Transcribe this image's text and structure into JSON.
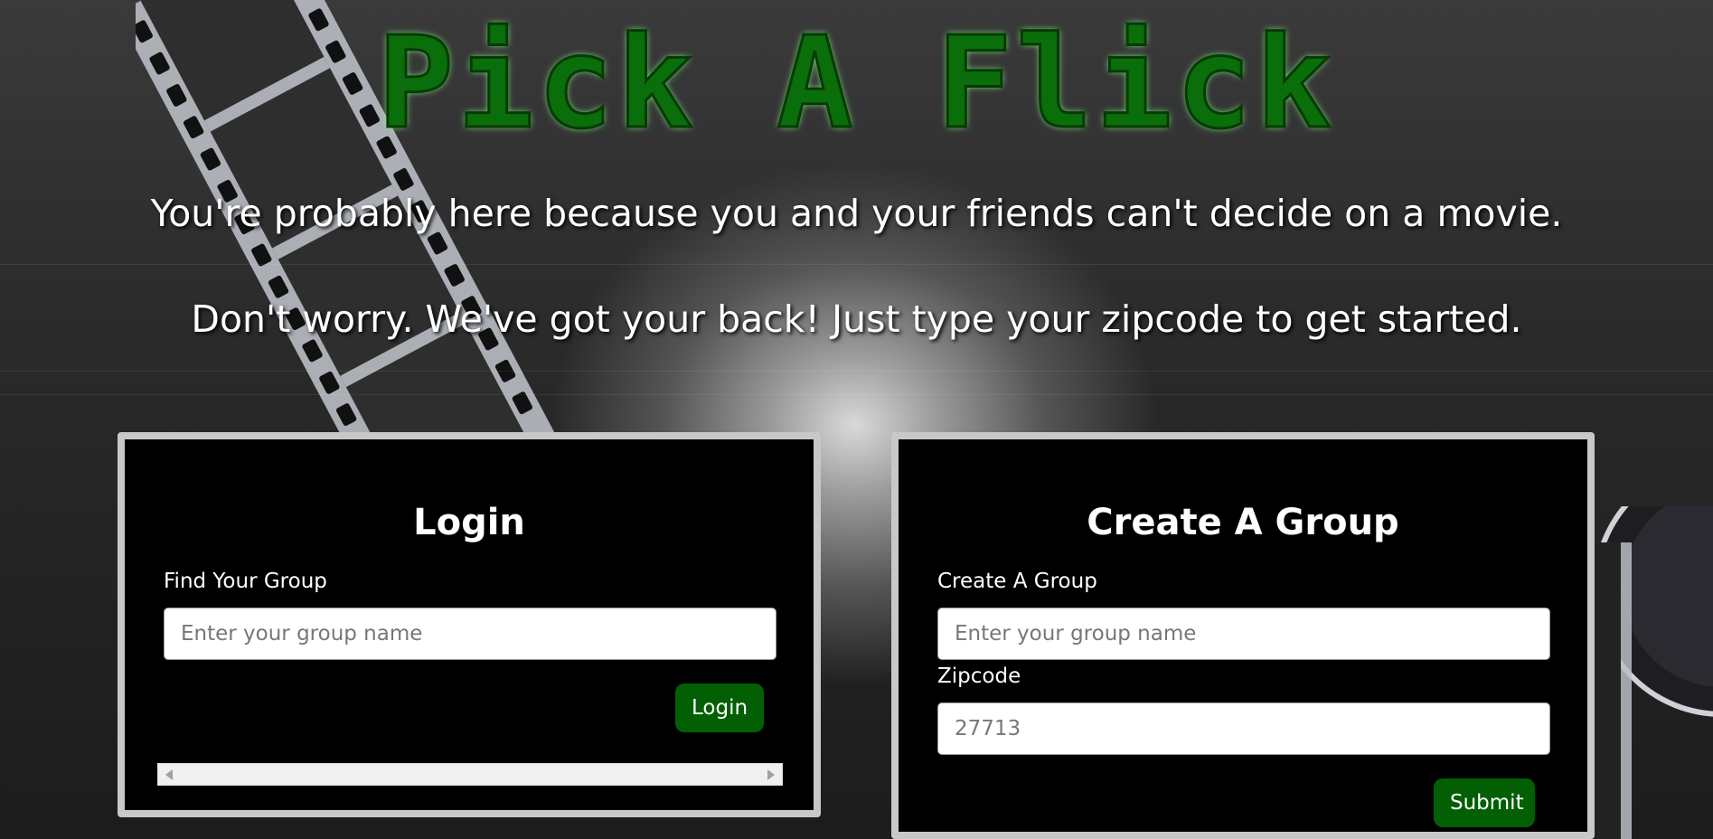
{
  "header": {
    "title": "Pick A Flick",
    "tagline_1": "You're probably here because you and your friends can't decide on a movie.",
    "tagline_2": "Don't worry. We've got your back! Just type your zipcode to get started."
  },
  "login_card": {
    "heading": "Login",
    "group_label": "Find Your Group",
    "group_placeholder": "Enter your group name",
    "button_label": "Login"
  },
  "group_card": {
    "heading": "Create A Group",
    "group_label": "Create A Group",
    "group_placeholder": "Enter your group name",
    "zip_label": "Zipcode",
    "zip_placeholder": "27713",
    "button_label": "Submit"
  },
  "colors": {
    "title_green": "#0a6e0a",
    "button_green": "#035f03",
    "card_background": "#000000",
    "card_border": "#c8c8c8"
  },
  "icons": {
    "background": "film-strip-icon",
    "reel": "film-reel-icon"
  }
}
